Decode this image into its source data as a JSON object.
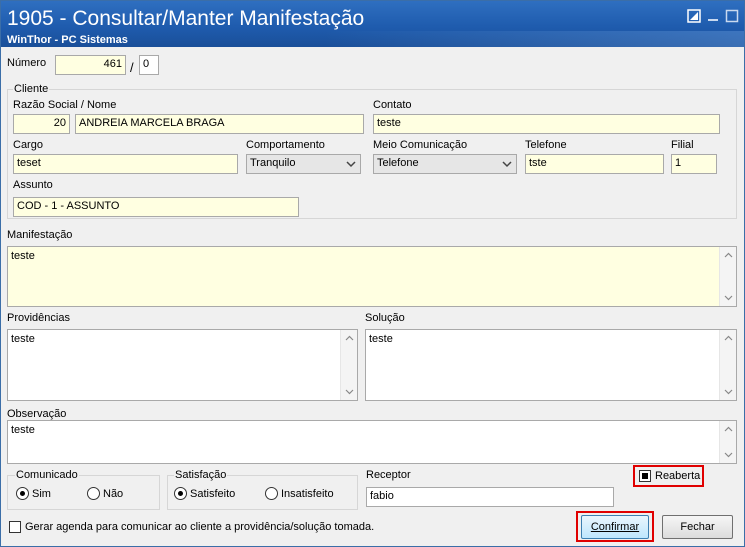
{
  "window": {
    "title": "1905 - Consultar/Manter Manifestação",
    "subtitle": "WinThor - PC Sistemas"
  },
  "numero": {
    "label": "Número",
    "value": "461",
    "separator": "/",
    "seq": "0"
  },
  "cliente": {
    "group_label": "Cliente",
    "razao_label": "Razão Social / Nome",
    "codigo": "20",
    "nome": "ANDREIA MARCELA BRAGA",
    "contato_label": "Contato",
    "contato": "teste",
    "cargo_label": "Cargo",
    "cargo": "teset",
    "comportamento_label": "Comportamento",
    "comportamento": "Tranquilo",
    "meio_label": "Meio Comunicação",
    "meio": "Telefone",
    "telefone_label": "Telefone",
    "telefone": "tste",
    "filial_label": "Filial",
    "filial": "1",
    "assunto_label": "Assunto",
    "assunto": "COD - 1 - ASSUNTO"
  },
  "manifestacao": {
    "label": "Manifestação",
    "text": "teste"
  },
  "providencias": {
    "label": "Providências",
    "text": "teste"
  },
  "solucao": {
    "label": "Solução",
    "text": "teste"
  },
  "observacao": {
    "label": "Observação",
    "text": "teste"
  },
  "comunicado": {
    "label": "Comunicado",
    "sim": "Sim",
    "nao": "Não",
    "selected": "Sim"
  },
  "satisfacao": {
    "label": "Satisfação",
    "satisfeito": "Satisfeito",
    "insatisfeito": "Insatisfeito",
    "selected": "Satisfeito"
  },
  "receptor": {
    "label": "Receptor",
    "value": "fabio"
  },
  "reaberta": {
    "label": "Reaberta",
    "checked": true
  },
  "agenda": {
    "label": "Gerar agenda para comunicar ao cliente a providência/solução tomada.",
    "checked": false
  },
  "buttons": {
    "confirmar": "Confirmar",
    "fechar": "Fechar"
  },
  "colors": {
    "title_bar": "#1f5cae",
    "field_yellow": "#ffffe1",
    "highlight_red": "#e00000"
  }
}
